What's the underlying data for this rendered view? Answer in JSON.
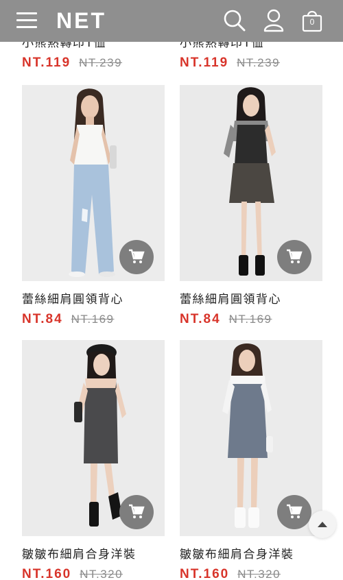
{
  "header": {
    "logo": "NET",
    "cart_count": "0",
    "icons": [
      "menu-icon",
      "search-icon",
      "user-icon",
      "shopping-bag-icon"
    ],
    "bar_color": "#8f8f8f"
  },
  "products": [
    {
      "name": "小熊熱轉印T恤",
      "price": "NT.119",
      "original_price": "NT.239"
    },
    {
      "name": "小熊熱轉印T恤",
      "price": "NT.119",
      "original_price": "NT.239"
    },
    {
      "name": "蕾絲細肩圓領背心",
      "price": "NT.84",
      "original_price": "NT.169",
      "image": "white tank top with light wash wide-leg jeans"
    },
    {
      "name": "蕾絲細肩圓領背心",
      "price": "NT.84",
      "original_price": "NT.169",
      "image": "black lace tank over grey tee with camo mini skirt"
    },
    {
      "name": "皺皺布細肩合身洋裝",
      "price": "NT.160",
      "original_price": "NT.320",
      "image": "dark grey fitted slip dress with black beret"
    },
    {
      "name": "皺皺布細肩合身洋裝",
      "price": "NT.160",
      "original_price": "NT.320",
      "image": "blue-grey slip dress over white tee"
    }
  ],
  "colors": {
    "sale_price": "#d8342a",
    "original_price": "#8a8a8a",
    "cart_button": "#7e7e7e"
  },
  "icons": {
    "cart_button": "cart-icon",
    "back_to_top": "arrow-up-icon"
  }
}
